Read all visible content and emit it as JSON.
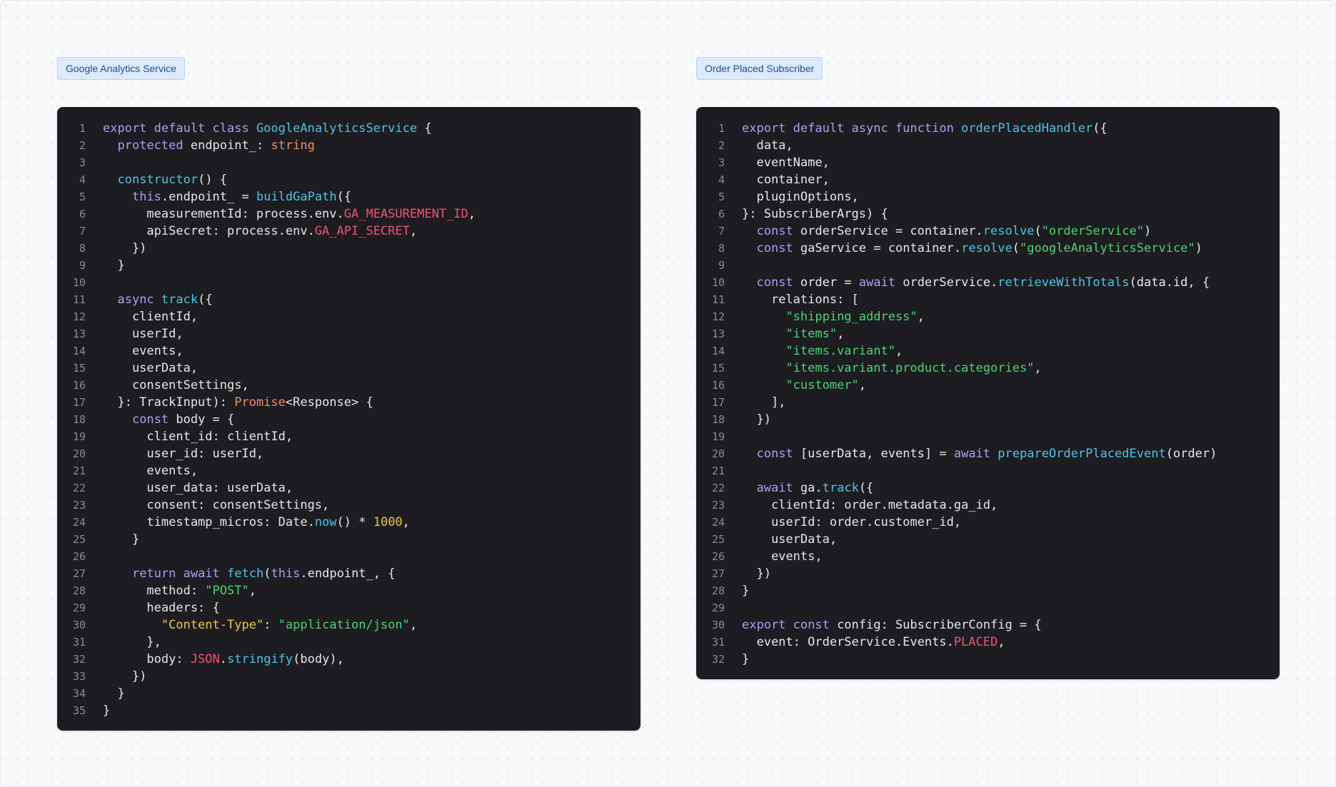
{
  "panels": [
    {
      "id": "left",
      "title": "Google Analytics Service",
      "lines": [
        [
          [
            "k",
            "export default class "
          ],
          [
            "f",
            "GoogleAnalyticsService"
          ],
          [
            "p",
            " {"
          ]
        ],
        [
          [
            "p",
            "  "
          ],
          [
            "k",
            "protected"
          ],
          [
            "p",
            " endpoint_: "
          ],
          [
            "y",
            "string"
          ]
        ],
        [],
        [
          [
            "p",
            "  "
          ],
          [
            "f",
            "constructor"
          ],
          [
            "p",
            "() {"
          ]
        ],
        [
          [
            "p",
            "    "
          ],
          [
            "k",
            "this"
          ],
          [
            "p",
            ".endpoint_ = "
          ],
          [
            "f",
            "buildGaPath"
          ],
          [
            "p",
            "({"
          ]
        ],
        [
          [
            "p",
            "      measurementId: process.env."
          ],
          [
            "c",
            "GA_MEASUREMENT_ID"
          ],
          [
            "p",
            ","
          ]
        ],
        [
          [
            "p",
            "      apiSecret: process.env."
          ],
          [
            "c",
            "GA_API_SECRET"
          ],
          [
            "p",
            ","
          ]
        ],
        [
          [
            "p",
            "    })"
          ]
        ],
        [
          [
            "p",
            "  }"
          ]
        ],
        [],
        [
          [
            "p",
            "  "
          ],
          [
            "k",
            "async"
          ],
          [
            "p",
            " "
          ],
          [
            "f",
            "track"
          ],
          [
            "p",
            "({"
          ]
        ],
        [
          [
            "p",
            "    clientId,"
          ]
        ],
        [
          [
            "p",
            "    userId,"
          ]
        ],
        [
          [
            "p",
            "    events,"
          ]
        ],
        [
          [
            "p",
            "    userData,"
          ]
        ],
        [
          [
            "p",
            "    consentSettings,"
          ]
        ],
        [
          [
            "p",
            "  }: TrackInput): "
          ],
          [
            "y",
            "Promise"
          ],
          [
            "p",
            "<Response> {"
          ]
        ],
        [
          [
            "p",
            "    "
          ],
          [
            "k",
            "const"
          ],
          [
            "p",
            " body = {"
          ]
        ],
        [
          [
            "p",
            "      client_id: clientId,"
          ]
        ],
        [
          [
            "p",
            "      user_id: userId,"
          ]
        ],
        [
          [
            "p",
            "      events,"
          ]
        ],
        [
          [
            "p",
            "      user_data: userData,"
          ]
        ],
        [
          [
            "p",
            "      consent: consentSettings,"
          ]
        ],
        [
          [
            "p",
            "      timestamp_micros: Date."
          ],
          [
            "f",
            "now"
          ],
          [
            "p",
            "() * "
          ],
          [
            "n",
            "1000"
          ],
          [
            "p",
            ","
          ]
        ],
        [
          [
            "p",
            "    }"
          ]
        ],
        [],
        [
          [
            "p",
            "    "
          ],
          [
            "k",
            "return await"
          ],
          [
            "p",
            " "
          ],
          [
            "f",
            "fetch"
          ],
          [
            "p",
            "("
          ],
          [
            "k",
            "this"
          ],
          [
            "p",
            ".endpoint_, {"
          ]
        ],
        [
          [
            "p",
            "      method: "
          ],
          [
            "s",
            "\"POST\""
          ],
          [
            "p",
            ","
          ]
        ],
        [
          [
            "p",
            "      headers: {"
          ]
        ],
        [
          [
            "p",
            "        "
          ],
          [
            "n",
            "\"Content-Type\""
          ],
          [
            "p",
            ": "
          ],
          [
            "s",
            "\"application/json\""
          ],
          [
            "p",
            ","
          ]
        ],
        [
          [
            "p",
            "      },"
          ]
        ],
        [
          [
            "p",
            "      body: "
          ],
          [
            "c",
            "JSON"
          ],
          [
            "p",
            "."
          ],
          [
            "f",
            "stringify"
          ],
          [
            "p",
            "(body),"
          ]
        ],
        [
          [
            "p",
            "    })"
          ]
        ],
        [
          [
            "p",
            "  }"
          ]
        ],
        [
          [
            "p",
            "}"
          ]
        ]
      ]
    },
    {
      "id": "right",
      "title": "Order Placed Subscriber",
      "lines": [
        [
          [
            "k",
            "export default async function "
          ],
          [
            "f",
            "orderPlacedHandler"
          ],
          [
            "p",
            "({"
          ]
        ],
        [
          [
            "p",
            "  data,"
          ]
        ],
        [
          [
            "p",
            "  eventName,"
          ]
        ],
        [
          [
            "p",
            "  container,"
          ]
        ],
        [
          [
            "p",
            "  pluginOptions,"
          ]
        ],
        [
          [
            "p",
            "}: SubscriberArgs) {"
          ]
        ],
        [
          [
            "p",
            "  "
          ],
          [
            "k",
            "const"
          ],
          [
            "p",
            " orderService = container."
          ],
          [
            "f",
            "resolve"
          ],
          [
            "p",
            "("
          ],
          [
            "s",
            "\"orderService\""
          ],
          [
            "p",
            ")"
          ]
        ],
        [
          [
            "p",
            "  "
          ],
          [
            "k",
            "const"
          ],
          [
            "p",
            " gaService = container."
          ],
          [
            "f",
            "resolve"
          ],
          [
            "p",
            "("
          ],
          [
            "s",
            "\"googleAnalyticsService\""
          ],
          [
            "p",
            ")"
          ]
        ],
        [],
        [
          [
            "p",
            "  "
          ],
          [
            "k",
            "const"
          ],
          [
            "p",
            " order = "
          ],
          [
            "k",
            "await"
          ],
          [
            "p",
            " orderService."
          ],
          [
            "f",
            "retrieveWithTotals"
          ],
          [
            "p",
            "(data.id, {"
          ]
        ],
        [
          [
            "p",
            "    relations: ["
          ]
        ],
        [
          [
            "p",
            "      "
          ],
          [
            "s",
            "\"shipping_address\""
          ],
          [
            "p",
            ","
          ]
        ],
        [
          [
            "p",
            "      "
          ],
          [
            "s",
            "\"items\""
          ],
          [
            "p",
            ","
          ]
        ],
        [
          [
            "p",
            "      "
          ],
          [
            "s",
            "\"items.variant\""
          ],
          [
            "p",
            ","
          ]
        ],
        [
          [
            "p",
            "      "
          ],
          [
            "s",
            "\"items.variant.product.categories\""
          ],
          [
            "p",
            ","
          ]
        ],
        [
          [
            "p",
            "      "
          ],
          [
            "s",
            "\"customer\""
          ],
          [
            "p",
            ","
          ]
        ],
        [
          [
            "p",
            "    ],"
          ]
        ],
        [
          [
            "p",
            "  })"
          ]
        ],
        [],
        [
          [
            "p",
            "  "
          ],
          [
            "k",
            "const"
          ],
          [
            "p",
            " [userData, events] = "
          ],
          [
            "k",
            "await"
          ],
          [
            "p",
            " "
          ],
          [
            "f",
            "prepareOrderPlacedEvent"
          ],
          [
            "p",
            "(order)"
          ]
        ],
        [],
        [
          [
            "p",
            "  "
          ],
          [
            "k",
            "await"
          ],
          [
            "p",
            " ga."
          ],
          [
            "f",
            "track"
          ],
          [
            "p",
            "({"
          ]
        ],
        [
          [
            "p",
            "    clientId: order.metadata.ga_id,"
          ]
        ],
        [
          [
            "p",
            "    userId: order.customer_id,"
          ]
        ],
        [
          [
            "p",
            "    userData,"
          ]
        ],
        [
          [
            "p",
            "    events,"
          ]
        ],
        [
          [
            "p",
            "  })"
          ]
        ],
        [
          [
            "p",
            "}"
          ]
        ],
        [],
        [
          [
            "k",
            "export const"
          ],
          [
            "p",
            " config: SubscriberConfig = {"
          ]
        ],
        [
          [
            "p",
            "  event: OrderService.Events."
          ],
          [
            "c",
            "PLACED"
          ],
          [
            "p",
            ","
          ]
        ],
        [
          [
            "p",
            "}"
          ]
        ]
      ]
    }
  ]
}
